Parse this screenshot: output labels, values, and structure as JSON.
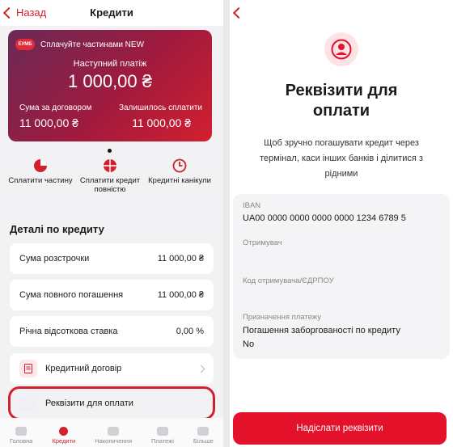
{
  "left": {
    "header": {
      "back_label": "Назад",
      "title": "Кредити"
    },
    "card": {
      "badge": "ЕУМБ",
      "promo": "Сплачуйте частинами NEW",
      "next_label": "Наступний платіж",
      "next_amount": "1 000,00 ₴",
      "contract_sum_label": "Сума за договором",
      "contract_sum": "11 000,00 ₴",
      "remaining_label": "Залишилось сплатити",
      "remaining": "11 000,00 ₴"
    },
    "actions": [
      {
        "label": "Сплатити частину",
        "icon": "pie-icon"
      },
      {
        "label": "Сплатити кредит повністю",
        "icon": "full-pie-icon"
      },
      {
        "label": "Кредитні канікули",
        "icon": "clock-icon"
      }
    ],
    "details_title": "Деталі по кредиту",
    "rows": [
      {
        "label": "Сума розстрочки",
        "value": "11 000,00 ₴"
      },
      {
        "label": "Сума повного погашення",
        "value": "11 000,00 ₴"
      },
      {
        "label": "Річна відсоткова ставка",
        "value": "0,00 %"
      }
    ],
    "contract_label": "Кредитний договір",
    "requisites_label": "Реквізити для оплати",
    "tabs": [
      {
        "label": "Головна",
        "active": false
      },
      {
        "label": "Кредити",
        "active": true
      },
      {
        "label": "Накопичення",
        "active": false
      },
      {
        "label": "Платежі",
        "active": false
      },
      {
        "label": "Більше",
        "active": false
      }
    ]
  },
  "right": {
    "title_line1": "Реквізити для",
    "title_line2": "оплати",
    "desc_line1": "Щоб зручно погашувати кредит через",
    "desc_line2": "термінал, каси інших банків і ділитися з",
    "desc_line3": "рідними",
    "iban_label": "IBAN",
    "iban_value": "UA00 0000 0000 0000 0000 1234 6789 5",
    "recipient_label": "Отримувач",
    "code_label": "Код отримувача/ЄДРПОУ",
    "purpose_label": "Призначення платежу",
    "purpose_line1": "Погашення заборгованості по кредиту",
    "purpose_line2": "No",
    "send_button": "Надіслати реквізити"
  },
  "colors": {
    "accent": "#d3202f",
    "card_gradient_start": "#6a2a56",
    "card_gradient_end": "#d3202f"
  }
}
